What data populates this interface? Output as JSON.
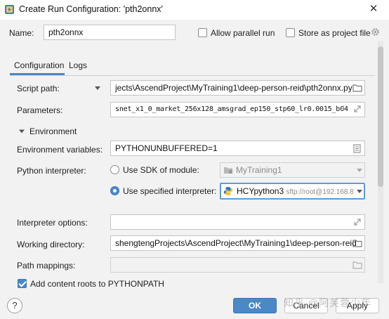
{
  "window": {
    "title": "Create Run Configuration: 'pth2onnx'",
    "close_label": "✕"
  },
  "top": {
    "name_label": "Name:",
    "name_value": "pth2onnx",
    "allow_parallel_label": "Allow parallel run",
    "allow_parallel_checked": false,
    "store_project_label": "Store as project file",
    "store_project_checked": false
  },
  "tabs": [
    {
      "label": "Configuration",
      "selected": true
    },
    {
      "label": "Logs",
      "selected": false
    }
  ],
  "form": {
    "script_path_label": "Script path:",
    "script_path_value": "jects\\AscendProject\\MyTraining1\\deep-person-reid\\pth2onnx.py",
    "parameters_label": "Parameters:",
    "parameters_value": "snet_x1_0_market_256x128_amsgrad_ep150_stp60_lr0.0015_b64",
    "environment_section": "Environment",
    "env_vars_label": "Environment variables:",
    "env_vars_value": "PYTHONUNBUFFERED=1",
    "python_interpreter_label": "Python interpreter:",
    "use_sdk_label": "Use SDK of module:",
    "use_sdk_selected": false,
    "sdk_module_value": "MyTraining1",
    "use_specified_label": "Use specified interpreter:",
    "use_specified_selected": true,
    "interpreter_name": "HCYpython3",
    "interpreter_detail": "sftp://root@192.168.8",
    "interpreter_options_label": "Interpreter options:",
    "interpreter_options_value": "",
    "working_dir_label": "Working directory:",
    "working_dir_value": "shengtengProjects\\AscendProject\\MyTraining1\\deep-person-reid",
    "path_mappings_label": "Path mappings:",
    "path_mappings_value": "",
    "content_roots_label": "Add content roots to PYTHONPATH",
    "content_roots_checked": true
  },
  "footer": {
    "help_label": "?",
    "ok_label": "OK",
    "cancel_label": "Cancel",
    "apply_label": "Apply",
    "watermark": "知乎 @阿芙蓉少年"
  },
  "colors": {
    "accent": "#4a88c7",
    "background": "#f2f2f2",
    "field_border": "#c4c4c4"
  }
}
